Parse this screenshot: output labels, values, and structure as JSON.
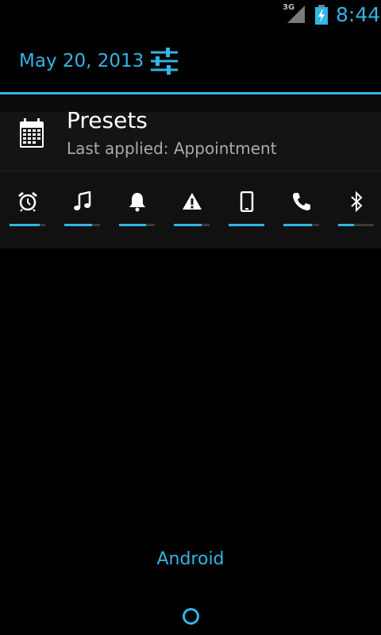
{
  "status_bar": {
    "network": "3G",
    "time": "8:44",
    "accent_color": "#33b5e5"
  },
  "header": {
    "date": "May 20, 2013",
    "settings_icon": "sliders-icon"
  },
  "preset": {
    "icon": "calendar-icon",
    "title": "Presets",
    "subtitle": "Last applied: Appointment"
  },
  "volume_levels": [
    {
      "name": "alarm",
      "icon": "alarm-clock-icon",
      "level": 0.85
    },
    {
      "name": "music",
      "icon": "music-note-icon",
      "level": 0.78
    },
    {
      "name": "ringer",
      "icon": "bell-icon",
      "level": 0.75
    },
    {
      "name": "notification",
      "icon": "warning-icon",
      "level": 0.78
    },
    {
      "name": "system",
      "icon": "phone-device-icon",
      "level": 1.0
    },
    {
      "name": "call",
      "icon": "phone-handset-icon",
      "level": 0.8
    },
    {
      "name": "bluetooth",
      "icon": "bluetooth-icon",
      "level": 0.45
    }
  ],
  "footer": {
    "carrier": "Android"
  }
}
